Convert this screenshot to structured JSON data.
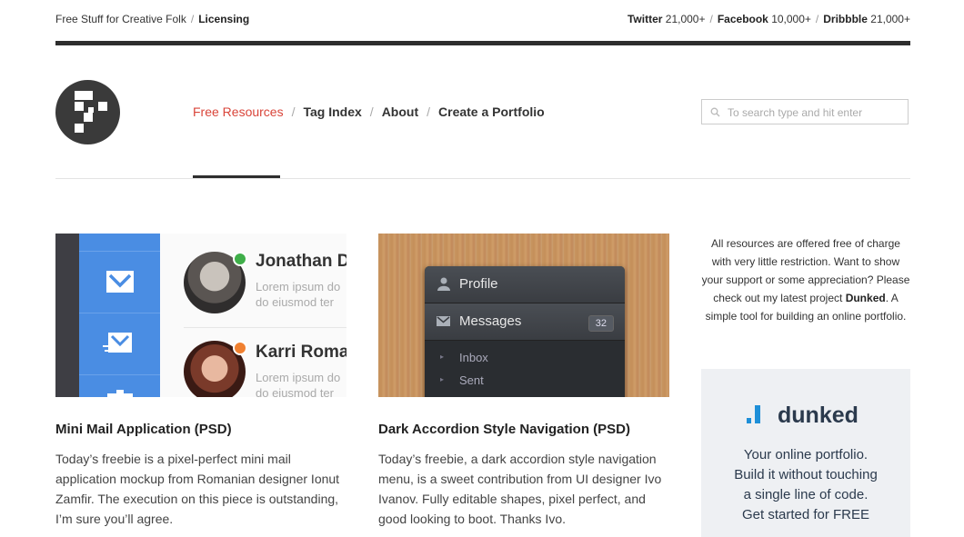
{
  "topbar": {
    "left_text": "Free Stuff for Creative Folk",
    "left_link": "Licensing",
    "social": [
      {
        "name": "Twitter",
        "count": "21,000+"
      },
      {
        "name": "Facebook",
        "count": "10,000+"
      },
      {
        "name": "Dribbble",
        "count": "21,000+"
      }
    ]
  },
  "nav": {
    "items": [
      "Free Resources",
      "Tag Index",
      "About",
      "Create a Portfolio"
    ],
    "active_color": "#d9453a"
  },
  "search": {
    "placeholder": "To search type and hit enter"
  },
  "cards": [
    {
      "title": "Mini Mail Application (PSD)",
      "text": "Today’s freebie is a pixel-perfect mini mail application mockup from Romanian designer Ionut Zamfir. The execution on this piece is outstanding, I’m sure you’ll agree.",
      "thumb": {
        "people": [
          {
            "name": "Jonathan D",
            "lorem1": "Lorem ipsum do",
            "lorem2": "do eiusmod ter",
            "status_color": "#3fae49"
          },
          {
            "name": "Karri Roman",
            "lorem1": "Lorem ipsum do",
            "lorem2": "do eiusmod ter",
            "status_color": "#f08030"
          }
        ]
      }
    },
    {
      "title": "Dark Accordion Style Navigation (PSD)",
      "text": "Today’s freebie, a dark accordion style navigation menu, is a sweet contribution from UI designer Ivo Ivanov. Fully editable shapes, pixel perfect, and good looking to boot. Thanks Ivo.",
      "thumb": {
        "profile": "Profile",
        "messages": "Messages",
        "badge": "32",
        "sub": [
          "Inbox",
          "Sent"
        ]
      }
    }
  ],
  "sidebar": {
    "intro": "All resources are offered free of charge with very little restriction. Want to show your support or some appreciation? Please check out my latest project",
    "project": "Dunked",
    "outro": ". A simple tool for building an online portfolio.",
    "ad": {
      "brand": "dunked",
      "lines": [
        "Your online portfolio.",
        "Build it without touching",
        "a single line of code.",
        "Get started for FREE"
      ]
    }
  }
}
